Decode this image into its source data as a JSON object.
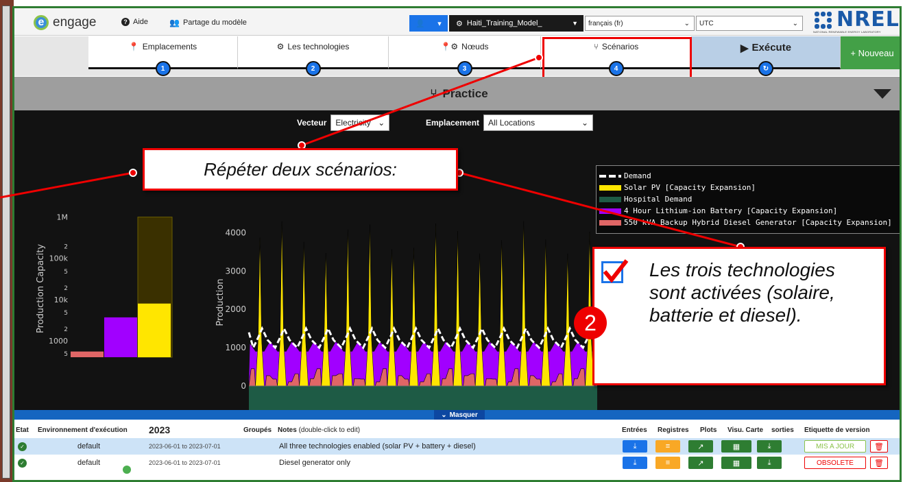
{
  "header": {
    "brand": "engage",
    "help": "Aide",
    "share": "Partage du modèle",
    "model": "Haiti_Training_Model_",
    "language": "français (fr)",
    "timezone": "UTC",
    "nrel": "NREL",
    "nrel_sub": "NATIONAL RENEWABLE ENERGY LABORATORY"
  },
  "steps": [
    {
      "label": "Emplacements",
      "num": "1"
    },
    {
      "label": "Les technologies",
      "num": "2"
    },
    {
      "label": "Nœuds",
      "num": "3"
    },
    {
      "label": "Scénarios",
      "num": "4"
    }
  ],
  "run": {
    "label": "Exécute"
  },
  "new_button": "+ Nouveau",
  "scenario_title": "Practice",
  "filters": {
    "vector_label": "Vecteur",
    "vector_value": "Electricity",
    "location_label": "Emplacement",
    "location_value": "All Locations"
  },
  "legend": [
    "Demand",
    "Solar PV [Capacity Expansion]",
    "Hospital Demand",
    "4 Hour Lithium-ion Battery [Capacity Expansion]",
    "550 kVA Backup Hybrid Diesel Generator  [Capacity Expansion]"
  ],
  "colors": {
    "demand": "#ffffff",
    "solar": "#ffe600",
    "hospital": "#1e5b45",
    "battery": "#a100ff",
    "diesel": "#e06666",
    "accent": "#1a73e8",
    "callout": "#e00000"
  },
  "chart_data": [
    {
      "type": "bar",
      "ylabel": "Production Capacity",
      "log_scale": true,
      "tick_labels": [
        "1000",
        "5",
        "2",
        "10k",
        "5",
        "2",
        "100k",
        "5",
        "2",
        "1M"
      ],
      "values": [
        550,
        3700,
        8000
      ],
      "colors": [
        "#e06666",
        "#a100ff",
        "#ffe600"
      ],
      "total_bar": 1000000
    },
    {
      "type": "area",
      "ylabel": "Production",
      "tick_labels": [
        "0",
        "1000",
        "2000",
        "3000",
        "4000"
      ],
      "ylim": [
        -1000,
        4500
      ],
      "peaks": 16,
      "solar_peak": 4300,
      "demand_level": 1300,
      "series": [
        "Demand",
        "Solar PV [Capacity Expansion]",
        "Hospital Demand",
        "4 Hour Lithium-ion Battery [Capacity Expansion]",
        "550 kVA Backup Hybrid Diesel Generator  [Capacity Expansion]"
      ]
    }
  ],
  "masquer": "Masquer",
  "table": {
    "headers": {
      "etat": "Etat",
      "env": "Environnement d'exécution",
      "year": "2023",
      "groups": "Groupés",
      "notes": "Notes",
      "notes_hint": "(double-click to edit)",
      "inputs": "Entrées",
      "logs": "Registres",
      "plots": "Plots",
      "map": "Visu. Carte",
      "outputs": "sorties",
      "version": "Etiquette de version"
    },
    "rows": [
      {
        "env": "default",
        "dates": "2023-06-01 to 2023-07-01",
        "note": "All three technologies enabled (solar PV + battery + diesel)",
        "version": "MIS A JOUR"
      },
      {
        "env": "default",
        "dates": "2023-06-01 to 2023-07-01",
        "note": "Diesel generator only",
        "version": "OBSOLETE"
      }
    ]
  },
  "callouts": {
    "repeat": "Répéter deux scénarios:",
    "tech_num": "2",
    "tech_text": "Les trois technologies sont activées (solaire, batterie et diesel)."
  }
}
